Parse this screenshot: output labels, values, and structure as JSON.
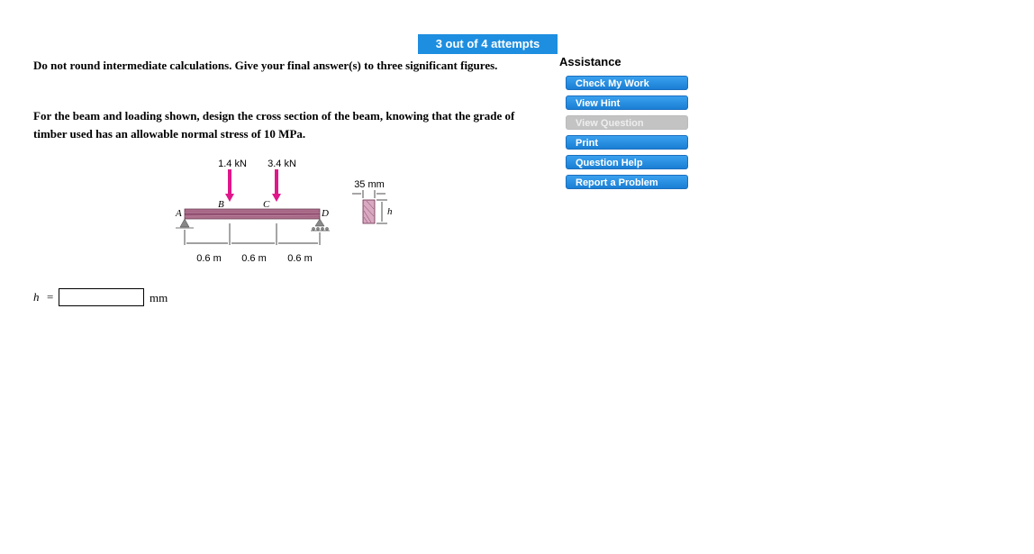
{
  "attempts": "3 out of 4 attempts",
  "instructions": "Do not round intermediate calculations. Give your final answer(s) to three significant figures.",
  "question": "For the beam and loading shown, design the cross section of the beam, knowing that the grade of timber used has an allowable normal stress of 10 MPa.",
  "assistance": {
    "title": "Assistance",
    "buttons": [
      {
        "label": "Check My Work",
        "enabled": true
      },
      {
        "label": "View Hint",
        "enabled": true
      },
      {
        "label": "View Question",
        "enabled": false
      },
      {
        "label": "Print",
        "enabled": true
      },
      {
        "label": "Question Help",
        "enabled": true
      },
      {
        "label": "Report a Problem",
        "enabled": true
      }
    ]
  },
  "figure": {
    "loads": [
      "1.4 kN",
      "3.4 kN"
    ],
    "points": [
      "A",
      "B",
      "C",
      "D"
    ],
    "spans": [
      "0.6 m",
      "0.6 m",
      "0.6 m"
    ],
    "section_width": "35 mm",
    "section_height_label": "h",
    "load_color": "#e0168a",
    "beam_color": "#9c5a7a"
  },
  "answer": {
    "variable": "h",
    "equals": "=",
    "value": "",
    "unit": "mm"
  }
}
